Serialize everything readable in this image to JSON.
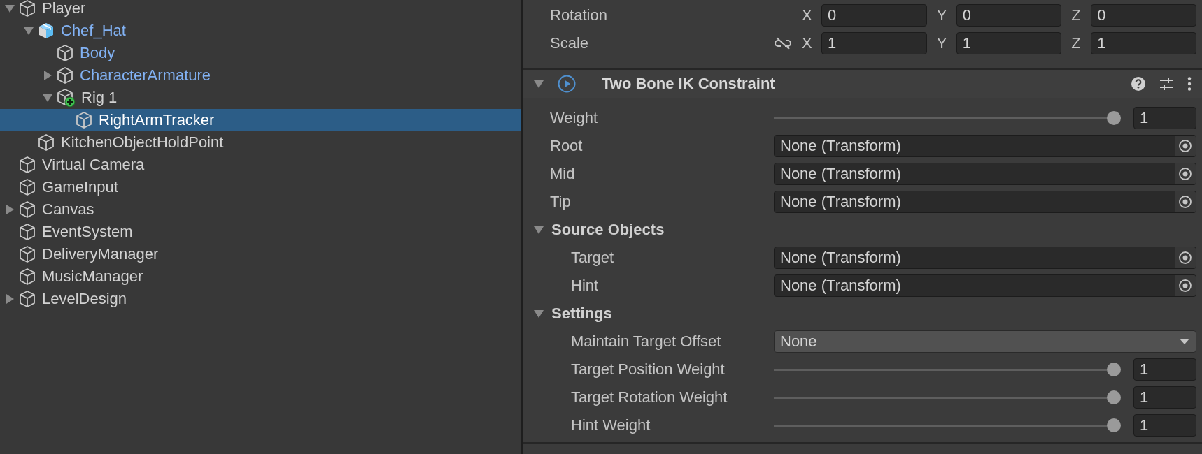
{
  "hierarchy": {
    "items": [
      {
        "label": "Player",
        "kind": "object",
        "prefab": false,
        "selected": false,
        "expanded": true,
        "children": [
          {
            "label": "Chef_Hat",
            "kind": "prefab",
            "prefab": true,
            "selected": false,
            "expanded": true,
            "children": [
              {
                "label": "Body",
                "kind": "object",
                "prefab": true,
                "selected": false
              },
              {
                "label": "CharacterArmature",
                "kind": "object",
                "prefab": true,
                "selected": false,
                "expanded": false
              },
              {
                "label": "Rig 1",
                "kind": "added",
                "prefab": false,
                "selected": false,
                "expanded": true,
                "children": [
                  {
                    "label": "RightArmTracker",
                    "kind": "object",
                    "prefab": false,
                    "selected": true
                  }
                ]
              }
            ]
          },
          {
            "label": "KitchenObjectHoldPoint",
            "kind": "object",
            "prefab": false,
            "selected": false
          }
        ]
      },
      {
        "label": "Virtual Camera",
        "kind": "object",
        "prefab": false,
        "selected": false
      },
      {
        "label": "GameInput",
        "kind": "object",
        "prefab": false,
        "selected": false
      },
      {
        "label": "Canvas",
        "kind": "object",
        "prefab": false,
        "selected": false,
        "expanded": false
      },
      {
        "label": "EventSystem",
        "kind": "object",
        "prefab": false,
        "selected": false
      },
      {
        "label": "DeliveryManager",
        "kind": "object",
        "prefab": false,
        "selected": false
      },
      {
        "label": "MusicManager",
        "kind": "object",
        "prefab": false,
        "selected": false
      },
      {
        "label": "LevelDesign",
        "kind": "object",
        "prefab": false,
        "selected": false,
        "expanded": false
      }
    ]
  },
  "inspector": {
    "transform_rows": [
      {
        "label": "Rotation",
        "fields": [
          {
            "axis": "X",
            "value": "0"
          },
          {
            "axis": "Y",
            "value": "0"
          },
          {
            "axis": "Z",
            "value": "0"
          }
        ]
      },
      {
        "label": "Scale",
        "linked": false,
        "fields": [
          {
            "axis": "X",
            "value": "1"
          },
          {
            "axis": "Y",
            "value": "1"
          },
          {
            "axis": "Z",
            "value": "1"
          }
        ]
      }
    ],
    "component": {
      "title": "Two Bone IK Constraint",
      "expanded": true,
      "properties": [
        {
          "kind": "slider",
          "label": "Weight",
          "level": 1,
          "value": "1"
        },
        {
          "kind": "object",
          "label": "Root",
          "value": "None (Transform)"
        },
        {
          "kind": "object",
          "label": "Mid",
          "value": "None (Transform)"
        },
        {
          "kind": "object",
          "label": "Tip",
          "value": "None (Transform)"
        },
        {
          "kind": "section",
          "label": "Source Objects",
          "expanded": true,
          "children": [
            {
              "kind": "object",
              "label": "Target",
              "value": "None (Transform)"
            },
            {
              "kind": "object",
              "label": "Hint",
              "value": "None (Transform)"
            }
          ]
        },
        {
          "kind": "section",
          "label": "Settings",
          "expanded": true,
          "children": [
            {
              "kind": "dropdown",
              "label": "Maintain Target Offset",
              "value": "None"
            },
            {
              "kind": "slider",
              "label": "Target Position Weight",
              "level": 1,
              "value": "1"
            },
            {
              "kind": "slider",
              "label": "Target Rotation Weight",
              "level": 1,
              "value": "1"
            },
            {
              "kind": "slider",
              "label": "Hint Weight",
              "level": 1,
              "value": "1"
            }
          ]
        }
      ]
    }
  }
}
